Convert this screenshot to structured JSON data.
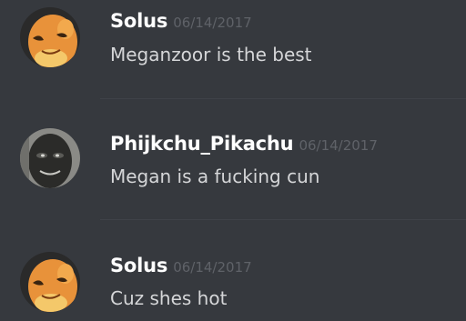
{
  "messages": [
    {
      "author": "Solus",
      "timestamp": "06/14/2017",
      "content": "Meganzoor is the best",
      "avatar": "charmander-avatar"
    },
    {
      "author": "Phijkchu_Pikachu",
      "timestamp": "06/14/2017",
      "content": "Megan is a fucking cun",
      "avatar": "dark-face-avatar"
    },
    {
      "author": "Solus",
      "timestamp": "06/14/2017",
      "content": "Cuz shes hot",
      "avatar": "charmander-avatar"
    }
  ],
  "colors": {
    "background": "#36393e",
    "username": "#ffffff",
    "timestamp": "#5f6268",
    "message_text": "#d5d6d8",
    "divider": "#3f4248"
  }
}
